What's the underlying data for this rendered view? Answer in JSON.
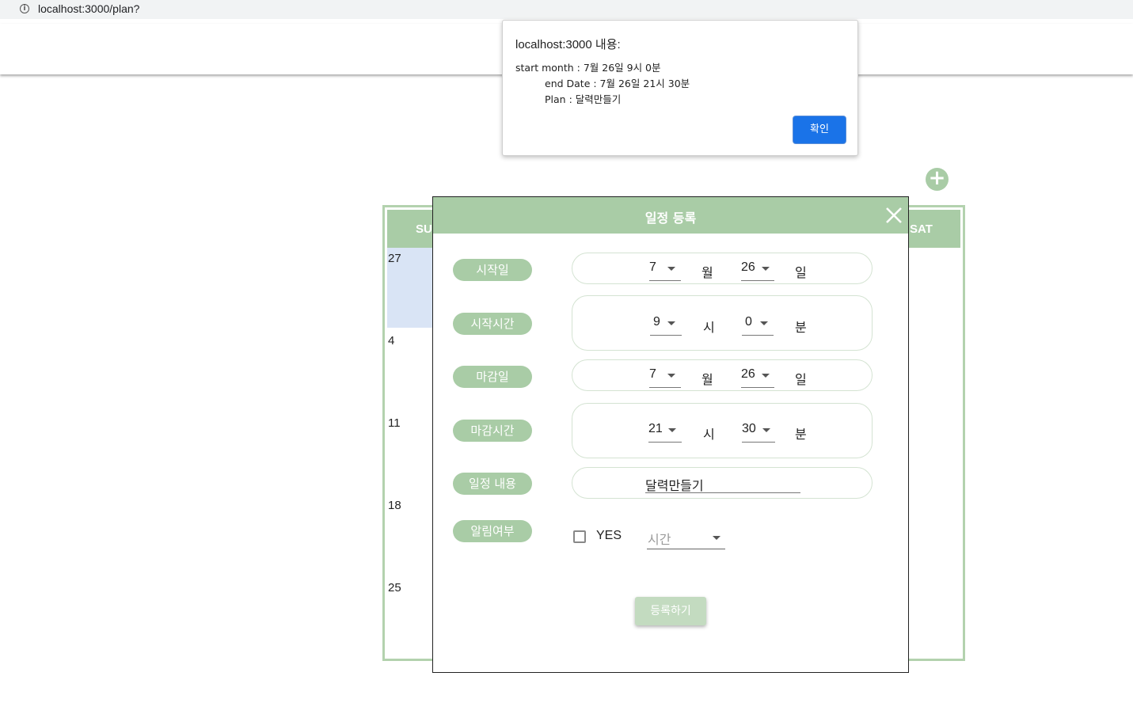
{
  "browser": {
    "url": "localhost:3000/plan?"
  },
  "fab": {
    "label": "+"
  },
  "calendar": {
    "weekday_visible_left": "SUN",
    "weekday_visible_right": "SAT",
    "days": [
      "27",
      "4",
      "11",
      "18",
      "25"
    ]
  },
  "modal": {
    "title": "일정 등록",
    "rows": {
      "start_date": {
        "label": "시작일",
        "month": "7",
        "month_unit": "월",
        "day": "26",
        "day_unit": "일"
      },
      "start_time": {
        "label": "시작시간",
        "hour": "9",
        "hour_unit": "시",
        "minute": "0",
        "minute_unit": "분"
      },
      "end_date": {
        "label": "마감일",
        "month": "7",
        "month_unit": "월",
        "day": "26",
        "day_unit": "일"
      },
      "end_time": {
        "label": "마감시간",
        "hour": "21",
        "hour_unit": "시",
        "minute": "30",
        "minute_unit": "분"
      },
      "content": {
        "label": "일정 내용",
        "value": "달력만들기"
      },
      "alarm": {
        "label": "알림여부",
        "checkbox_label": "YES",
        "time_placeholder": "시간"
      }
    },
    "submit_label": "등록하기"
  },
  "alert": {
    "title": "localhost:3000 내용:",
    "line1": "start month : 7월 26일 9시 0분",
    "line2": "end Date : 7월 26일 21시 30분",
    "line3": "Plan : 달력만들기",
    "ok_label": "확인"
  },
  "colors": {
    "accent_green": "#a9cca6",
    "dialog_blue": "#1a73e8",
    "highlight_blue": "#d9e4f5"
  }
}
